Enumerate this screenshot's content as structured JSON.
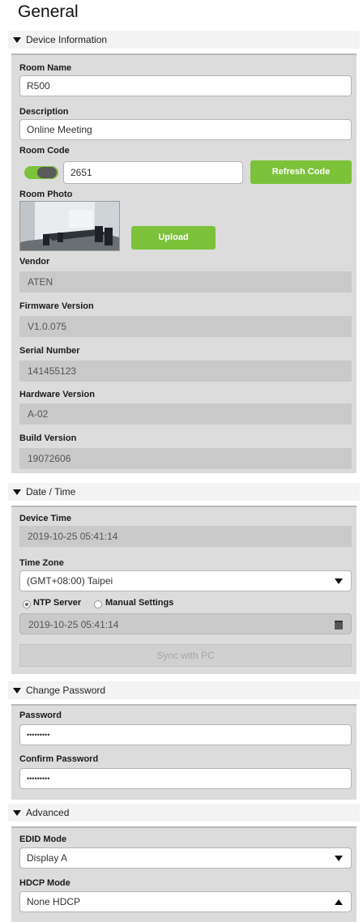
{
  "page_title": "General",
  "device_info": {
    "header": "Device Information",
    "room_name_label": "Room Name",
    "room_name_value": "R500",
    "description_label": "Description",
    "description_value": "Online Meeting",
    "room_code_label": "Room Code",
    "room_code_value": "2651",
    "refresh_code_label": "Refresh Code",
    "room_photo_label": "Room Photo",
    "upload_label": "Upload",
    "vendor_label": "Vendor",
    "vendor_value": "ATEN",
    "firmware_label": "Firmware Version",
    "firmware_value": "V1.0.075",
    "serial_label": "Serial Number",
    "serial_value": "141455123",
    "hardware_label": "Hardware Version",
    "hardware_value": "A-02",
    "build_label": "Build Version",
    "build_value": "19072606"
  },
  "date_time": {
    "header": "Date / Time",
    "device_time_label": "Device Time",
    "device_time_value": "2019-10-25 05:41:14",
    "timezone_label": "Time Zone",
    "timezone_value": "(GMT+08:00) Taipei",
    "ntp_label": "NTP Server",
    "manual_label": "Manual Settings",
    "manual_time_value": "2019-10-25 05:41:14",
    "sync_label": "Sync with PC"
  },
  "change_password": {
    "header": "Change Password",
    "password_label": "Password",
    "password_value": "•••••••••",
    "confirm_label": "Confirm Password",
    "confirm_value": "•••••••••"
  },
  "advanced": {
    "header": "Advanced",
    "edid_label": "EDID Mode",
    "edid_value": "Display A",
    "hdcp_label": "HDCP Mode",
    "hdcp_value": "None HDCP"
  },
  "colors": {
    "accent_green": "#7cc23b",
    "panel_bg": "#dcdcdc",
    "readonly_bg": "#c9c9c9"
  },
  "icons": {
    "room_code_toggle": "toggle-on",
    "calendar": "calendar-icon"
  }
}
